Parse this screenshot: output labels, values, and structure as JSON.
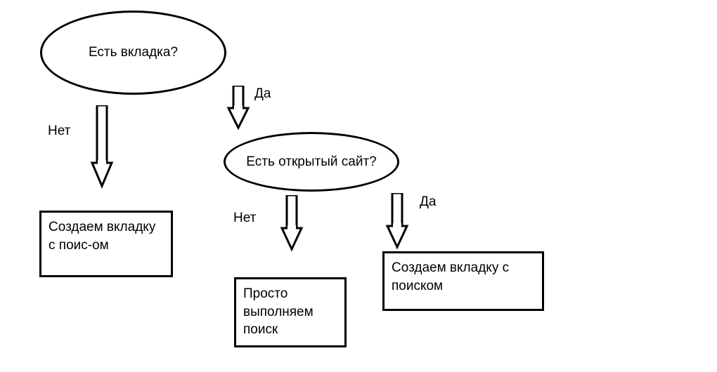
{
  "nodes": {
    "decision1": "Есть вкладка?",
    "decision2": "Есть открытый сайт?",
    "action1": "Создаем вкладку с поис-ом",
    "action2": "Просто выполняем поиск",
    "action3": "Создаем вкладку с поиском"
  },
  "labels": {
    "no1": "Нет",
    "yes1": "Да",
    "no2": "Нет",
    "yes2": "Да"
  }
}
